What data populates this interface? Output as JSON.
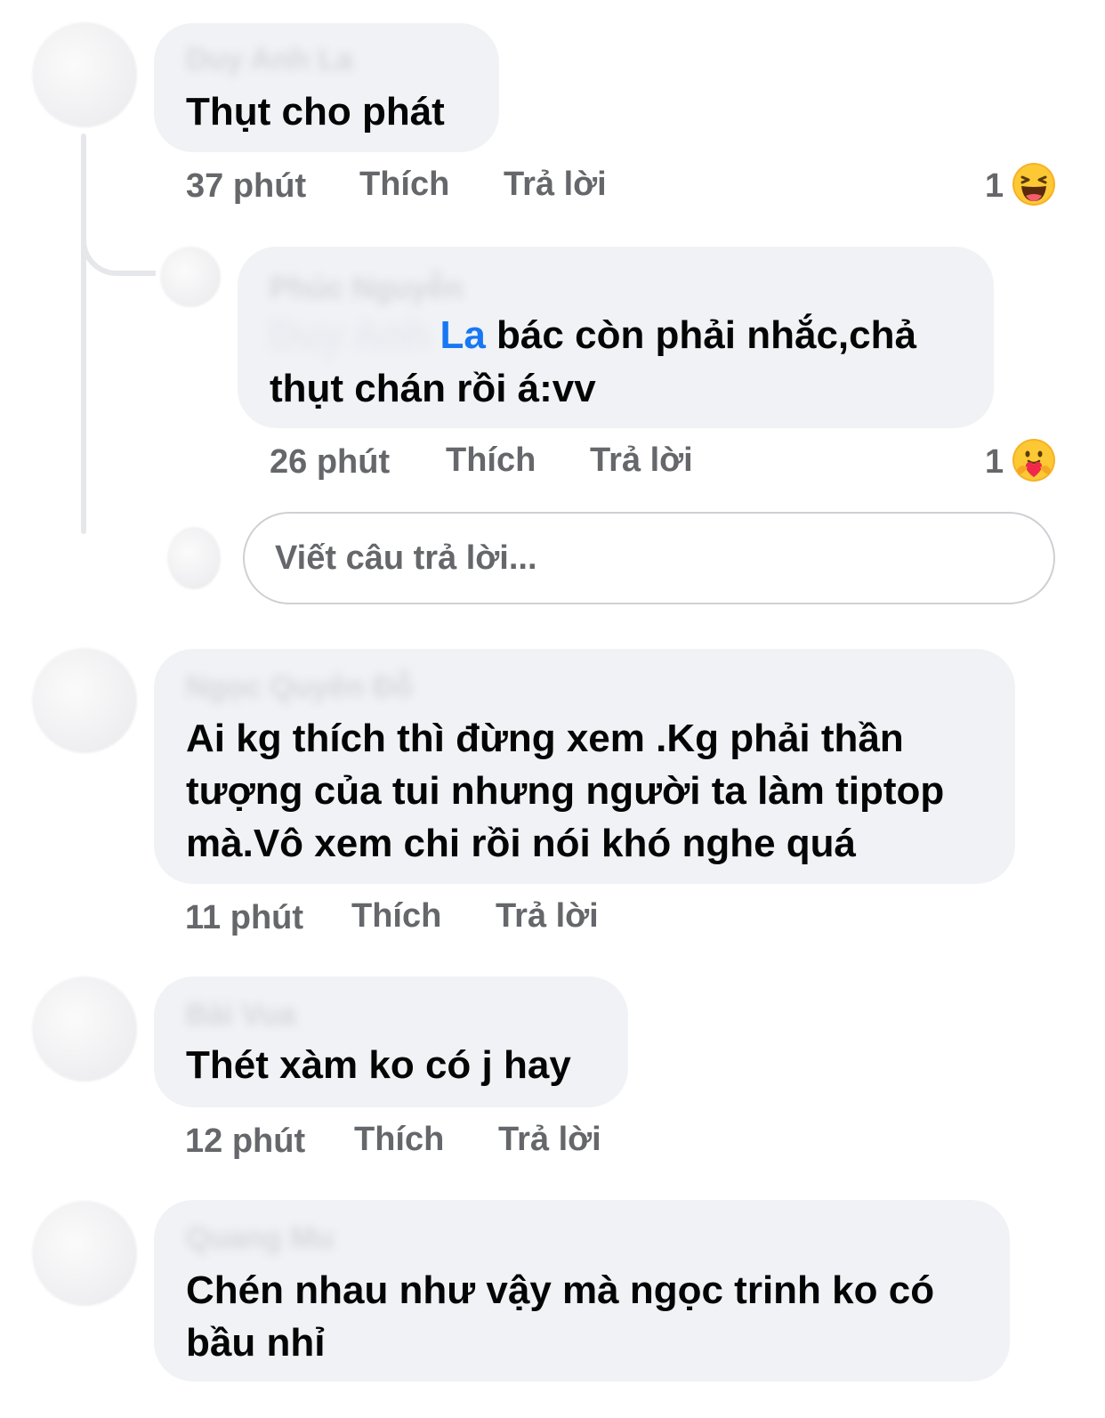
{
  "comments": [
    {
      "author": "Duy Anh La",
      "text": "Thụt cho phát",
      "time": "37 phút",
      "like_label": "Thích",
      "reply_label": "Trả lời",
      "reaction": {
        "count": "1",
        "icon": "laughing-emoji"
      }
    },
    {
      "author": "Phúc Nguyễn",
      "mention_hidden": "Duy Anh ",
      "mention_visible": "La",
      "text_line1": " bác còn phải nhắc,chả",
      "text_line2": "thụt chán rồi á:vv",
      "time": "26 phút",
      "like_label": "Thích",
      "reply_label": "Trả lời",
      "reaction": {
        "count": "1",
        "icon": "care-hug-emoji"
      }
    },
    {
      "author": "Ngọc Quyên Đỗ",
      "lines": [
        "Ai kg thích thì đừng xem .Kg phải thần",
        "tượng của tui nhưng người ta làm tiptop",
        "mà.Vô xem chi rồi nói khó nghe quá"
      ],
      "time": "11 phút",
      "like_label": "Thích",
      "reply_label": "Trả lời"
    },
    {
      "author": "Bài Vua",
      "text": "Thét xàm ko có j hay",
      "time": "12 phút",
      "like_label": "Thích",
      "reply_label": "Trả lời"
    },
    {
      "author": "Quang Mu",
      "lines": [
        "Chén nhau như vậy mà ngọc trinh ko có",
        "bầu nhỉ"
      ]
    }
  ],
  "reply_box": {
    "placeholder": "Viết câu trả lời..."
  },
  "colors": {
    "bubble": "#f0f2f5",
    "meta_text": "#65676b",
    "mention": "#1877f2",
    "input_border": "#ced0d4"
  }
}
